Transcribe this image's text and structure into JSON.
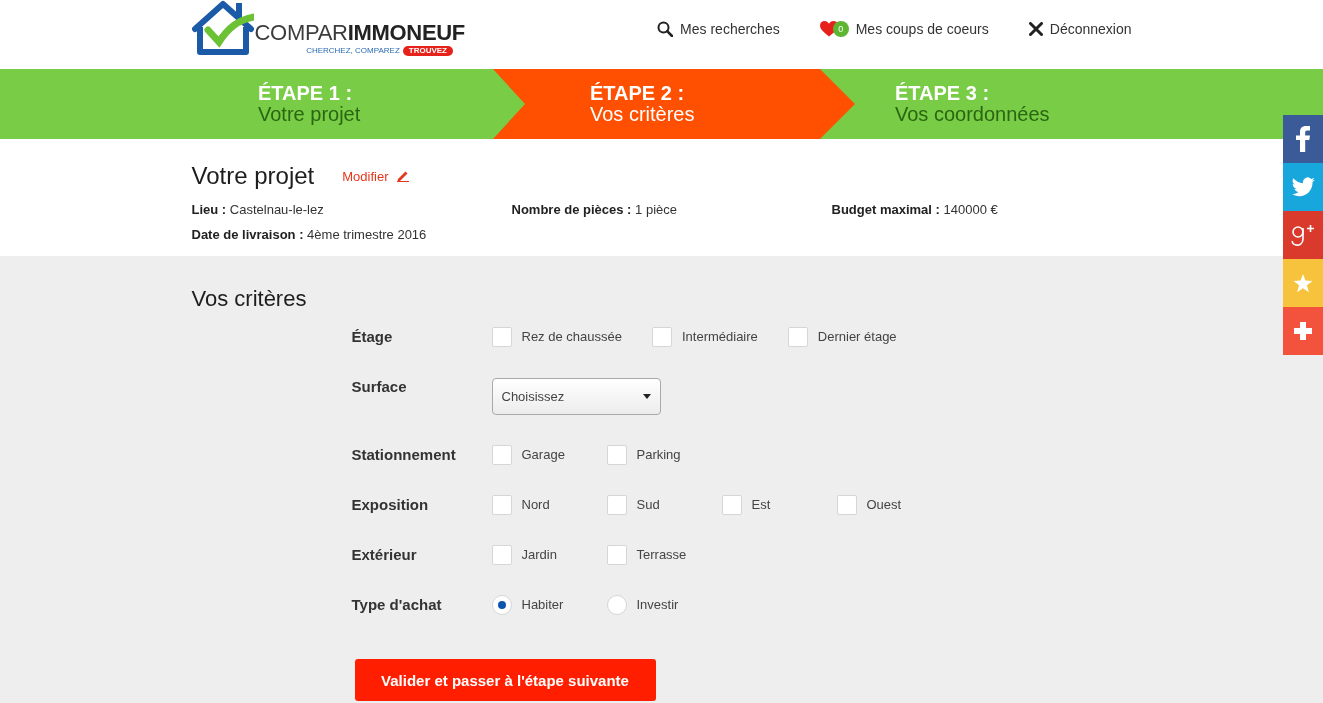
{
  "header": {
    "logo": {
      "name": "COMPAR**IMMONEUF**",
      "tagline": "CHERCHEZ, COMPAREZ",
      "highlight": "TROUVEZ"
    },
    "nav": [
      {
        "kind": "search",
        "label": "Mes recherches"
      },
      {
        "kind": "favorites",
        "label": "Mes coups de coeurs",
        "count": "0"
      },
      {
        "kind": "logout",
        "label": "Déconnexion"
      }
    ]
  },
  "steps": [
    {
      "title": "ÉTAPE 1 :",
      "subtitle": "Votre projet",
      "selected": false
    },
    {
      "title": "ÉTAPE 2 :",
      "subtitle": "Vos critères",
      "selected": true
    },
    {
      "title": "ÉTAPE 3 :",
      "subtitle": "Vos coordonnées",
      "selected": false
    }
  ],
  "share_bar": [
    {
      "kind": "facebook"
    },
    {
      "kind": "twitter"
    },
    {
      "kind": "google-plus"
    },
    {
      "kind": "favorite"
    },
    {
      "kind": "more"
    }
  ],
  "project": {
    "title": "Votre projet",
    "edit_link": "Modifier",
    "details": [
      {
        "label": "Lieu :",
        "value": "Castelnau-le-lez"
      },
      {
        "label": "Nombre de pièces :",
        "value": "1 pièce"
      },
      {
        "label": "Budget maximal :",
        "value": "140000 €"
      },
      {
        "label": "Date de livraison :",
        "value": "4ème trimestre 2016"
      }
    ]
  },
  "criteria": {
    "title": "Vos critères",
    "rows": [
      {
        "label": "Étage",
        "kind": "checkboxes",
        "options": [
          {
            "label": "Rez de chaussée",
            "checked": false
          },
          {
            "label": "Intermédiaire",
            "checked": false
          },
          {
            "label": "Dernier étage",
            "checked": false
          }
        ]
      },
      {
        "label": "Surface",
        "kind": "select",
        "value": "Choisissez"
      },
      {
        "label": "Stationnement",
        "kind": "checkboxes",
        "options": [
          {
            "label": "Garage",
            "checked": false
          },
          {
            "label": "Parking",
            "checked": false
          }
        ]
      },
      {
        "label": "Exposition",
        "kind": "checkboxes",
        "options": [
          {
            "label": "Nord",
            "checked": false
          },
          {
            "label": "Sud",
            "checked": false
          },
          {
            "label": "Est",
            "checked": false
          },
          {
            "label": "Ouest",
            "checked": false
          }
        ]
      },
      {
        "label": "Extérieur",
        "kind": "checkboxes",
        "options": [
          {
            "label": "Jardin",
            "checked": false
          },
          {
            "label": "Terrasse",
            "checked": false
          }
        ]
      },
      {
        "label": "Type d'achat",
        "kind": "radios",
        "options": [
          {
            "label": "Habiter",
            "selected": true
          },
          {
            "label": "Investir",
            "selected": false
          }
        ]
      }
    ],
    "submit": "Valider et passer à l'étape suivante"
  }
}
